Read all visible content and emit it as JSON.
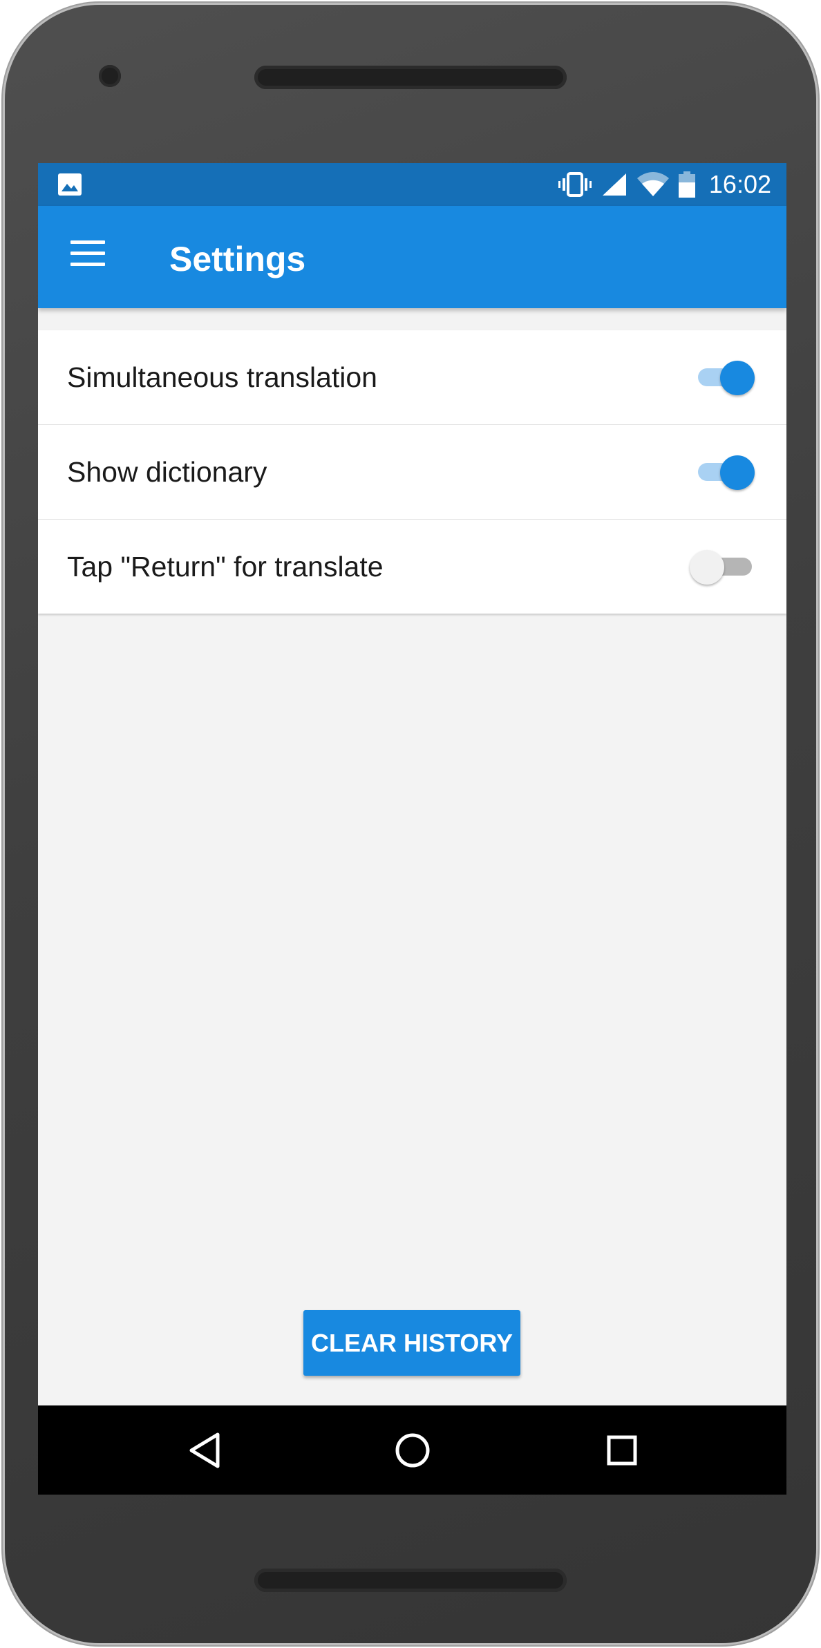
{
  "status_bar": {
    "time": "16:02"
  },
  "app_bar": {
    "title": "Settings"
  },
  "settings": [
    {
      "label": "Simultaneous translation",
      "enabled": true
    },
    {
      "label": "Show dictionary",
      "enabled": true
    },
    {
      "label": "Tap \"Return\" for translate",
      "enabled": false
    }
  ],
  "actions": {
    "clear_history": "CLEAR HISTORY"
  },
  "colors": {
    "primary": "#1889e0",
    "status_bar": "#156fb7",
    "switch_track_on": "#a9d1f3"
  },
  "icons": [
    "image-icon",
    "vibrate-icon",
    "signal-icon",
    "wifi-icon",
    "battery-icon",
    "menu-icon",
    "back-icon",
    "home-icon",
    "recents-icon"
  ]
}
